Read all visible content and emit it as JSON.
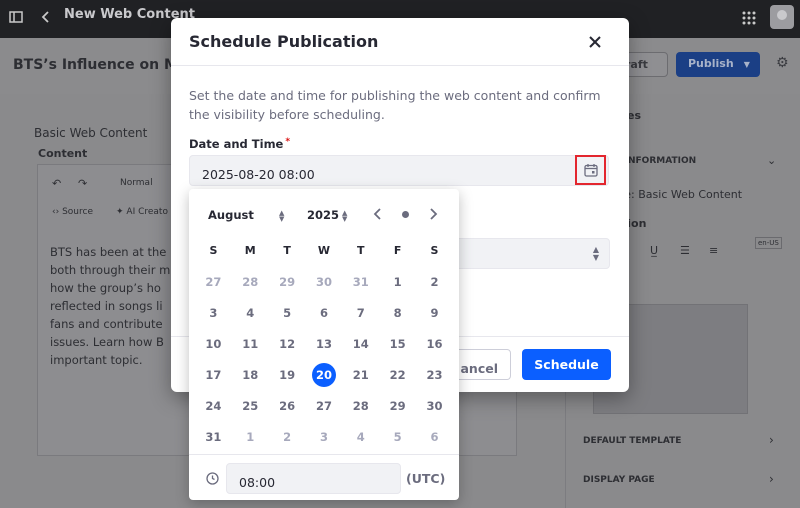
{
  "app": {
    "page_title": "New Web Content",
    "article_title": "BTS’s Influence on M",
    "draft_label": "raft",
    "publish_label": "Publish",
    "content_type": "Basic Web Content",
    "content_label": "Content",
    "format_label": "Normal",
    "source_label": "Source",
    "ai_label": "AI Creato",
    "body_lines": [
      "BTS has been at the",
      "both through their m",
      "how the group’s ho",
      "reflected in songs li",
      "fans and contribute",
      "issues. Learn how B",
      "important topic."
    ]
  },
  "sidebar": {
    "tab_label": "ties",
    "section_label": "NFORMATION",
    "structure_text": "re: Basic Web Content",
    "translation_label": "tion",
    "locale_badge": "en-US",
    "default_template": "DEFAULT TEMPLATE",
    "display_page": "DISPLAY PAGE"
  },
  "modal": {
    "title": "Schedule Publication",
    "description": "Set the date and time for publishing the web content and confirm the visibility before scheduling.",
    "date_label": "Date and Time",
    "required_mark": "*",
    "date_value": "2025-08-20 08:00",
    "cancel_label": "ancel",
    "schedule_label": "Schedule"
  },
  "picker": {
    "month": "August",
    "year": "2025",
    "weekdays": [
      "S",
      "M",
      "T",
      "W",
      "T",
      "F",
      "S"
    ],
    "weeks": [
      [
        {
          "d": "27",
          "o": true
        },
        {
          "d": "28",
          "o": true
        },
        {
          "d": "29",
          "o": true
        },
        {
          "d": "30",
          "o": true
        },
        {
          "d": "31",
          "o": true
        },
        {
          "d": "1"
        },
        {
          "d": "2"
        }
      ],
      [
        {
          "d": "3"
        },
        {
          "d": "4"
        },
        {
          "d": "5"
        },
        {
          "d": "6"
        },
        {
          "d": "7"
        },
        {
          "d": "8"
        },
        {
          "d": "9"
        }
      ],
      [
        {
          "d": "10"
        },
        {
          "d": "11"
        },
        {
          "d": "12"
        },
        {
          "d": "13"
        },
        {
          "d": "14"
        },
        {
          "d": "15"
        },
        {
          "d": "16"
        }
      ],
      [
        {
          "d": "17"
        },
        {
          "d": "18"
        },
        {
          "d": "19"
        },
        {
          "d": "20",
          "s": true
        },
        {
          "d": "21"
        },
        {
          "d": "22"
        },
        {
          "d": "23"
        }
      ],
      [
        {
          "d": "24"
        },
        {
          "d": "25"
        },
        {
          "d": "26"
        },
        {
          "d": "27"
        },
        {
          "d": "28"
        },
        {
          "d": "29"
        },
        {
          "d": "30"
        }
      ],
      [
        {
          "d": "31"
        },
        {
          "d": "1",
          "o": true
        },
        {
          "d": "2",
          "o": true
        },
        {
          "d": "3",
          "o": true
        },
        {
          "d": "4",
          "o": true
        },
        {
          "d": "5",
          "o": true
        },
        {
          "d": "6",
          "o": true
        }
      ]
    ],
    "time_value": "08:00",
    "timezone": "(UTC)"
  },
  "colors": {
    "primary": "#0b5fff",
    "highlight": "#e3262e"
  },
  "icons": {
    "close": "close-icon",
    "calendar": "calendar-icon",
    "clock": "clock-icon",
    "prev": "chevron-left-icon",
    "next": "chevron-right-icon",
    "today": "dot-icon"
  }
}
